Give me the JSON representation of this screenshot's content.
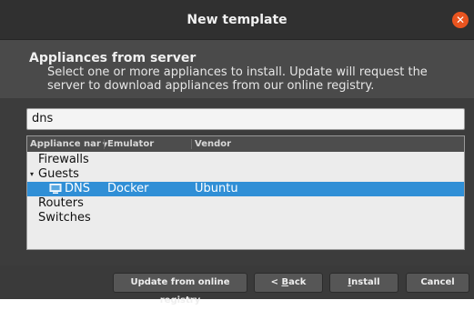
{
  "dialog": {
    "title": "New template",
    "close_icon": "close-icon",
    "accent_color": "#e9541f"
  },
  "header": {
    "title": "Appliances from server",
    "description": "Select one or more appliances to install. Update will request the server to download appliances from our online registry."
  },
  "search": {
    "value": "dns"
  },
  "tree": {
    "columns": [
      "Appliance nar",
      "Emulator",
      "Vendor"
    ],
    "sort_indicator": "▼",
    "rows": [
      {
        "name": "Firewalls",
        "emulator": "",
        "vendor": ""
      },
      {
        "name": "Guests",
        "emulator": "",
        "vendor": "",
        "expander": "▾"
      },
      {
        "name": "DNS",
        "emulator": "Docker",
        "vendor": "Ubuntu",
        "icon": "computer-icon"
      },
      {
        "name": "Routers",
        "emulator": "",
        "vendor": ""
      },
      {
        "name": "Switches",
        "emulator": "",
        "vendor": ""
      }
    ],
    "selected_color": "#308fd6"
  },
  "footer": {
    "update_label": "Update from online registry",
    "back_prefix": "< ",
    "back_mnemonic": "B",
    "back_rest": "ack",
    "install_mnemonic": "I",
    "install_rest": "nstall",
    "cancel_label": "Cancel"
  }
}
